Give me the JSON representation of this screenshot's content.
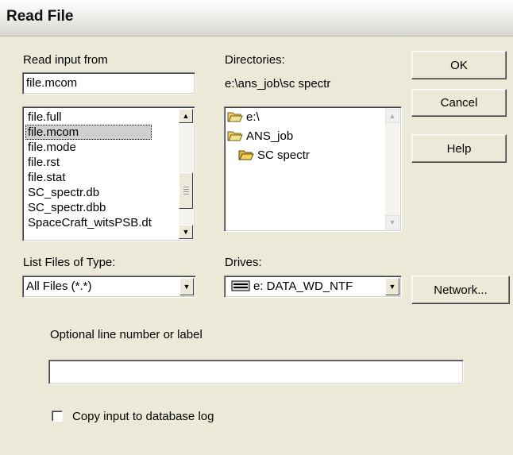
{
  "dialog": {
    "title": "Read File"
  },
  "read_input": {
    "label": "Read input from",
    "value": "file.mcom",
    "files": [
      "file.full",
      "file.mcom",
      "file.mode",
      "file.rst",
      "file.stat",
      "SC_spectr.db",
      "SC_spectr.dbb",
      "SpaceCraft_witsPSB.dt"
    ],
    "selected_index": 1
  },
  "directories": {
    "label": "Directories:",
    "current_path": "e:\\ans_job\\sc spectr",
    "items": [
      "e:\\",
      "ANS_job",
      "SC spectr"
    ]
  },
  "buttons": {
    "ok": "OK",
    "cancel": "Cancel",
    "help": "Help",
    "network": "Network..."
  },
  "file_type": {
    "label": "List Files of Type:",
    "value": "All Files (*.*)"
  },
  "drives": {
    "label": "Drives:",
    "value": "e: DATA_WD_NTF"
  },
  "optional": {
    "label": "Optional line number or label",
    "value": ""
  },
  "copy_log": {
    "label": "Copy input to database log",
    "checked": false
  },
  "colors": {
    "dialog_bg": "#ece9d8",
    "folder": "#f2d35e",
    "selection": "#cfcfcf"
  }
}
